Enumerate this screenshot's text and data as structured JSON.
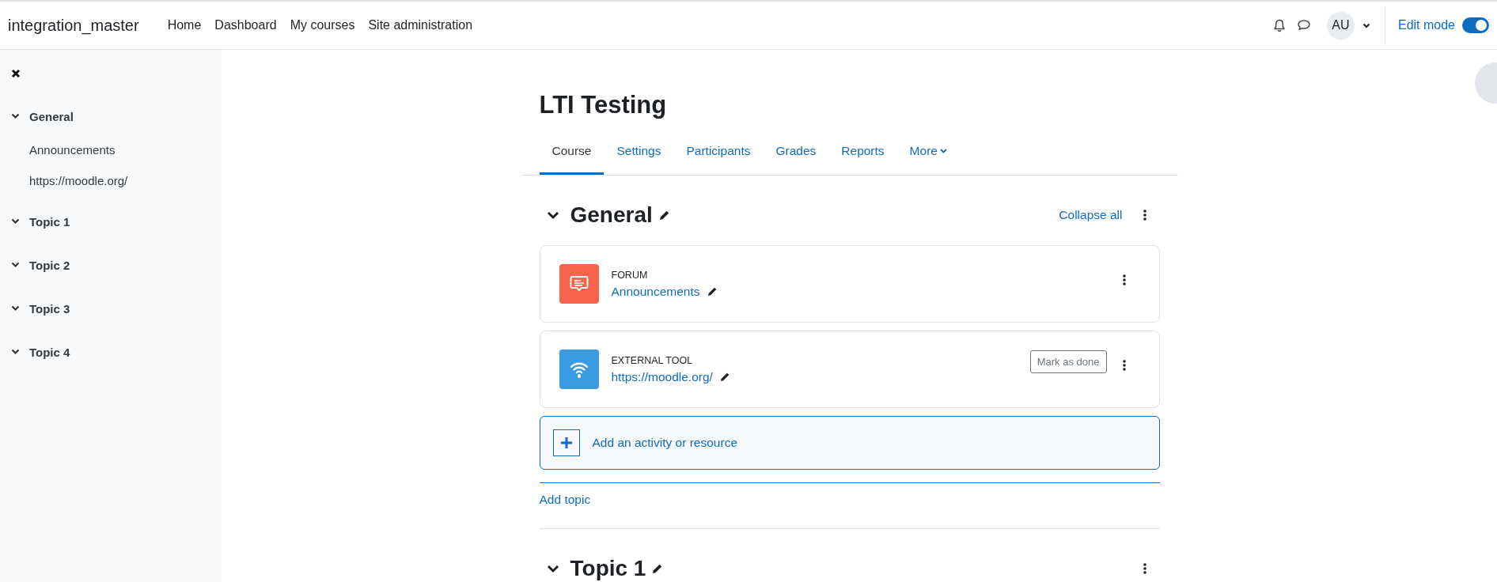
{
  "navbar": {
    "site_name": "integration_master",
    "links": [
      "Home",
      "Dashboard",
      "My courses",
      "Site administration"
    ],
    "avatar": "AU",
    "edit_mode": {
      "label": "Edit mode",
      "on": true
    }
  },
  "sidebar": {
    "sections": [
      {
        "title": "General",
        "expanded": true,
        "children": [
          {
            "label": "Announcements"
          },
          {
            "label": "https://moodle.org/"
          }
        ]
      },
      {
        "title": "Topic 1",
        "expanded": true
      },
      {
        "title": "Topic 2",
        "expanded": true
      },
      {
        "title": "Topic 3",
        "expanded": true
      },
      {
        "title": "Topic 4",
        "expanded": true
      }
    ]
  },
  "course": {
    "title": "LTI Testing",
    "tabs": [
      {
        "label": "Course",
        "selected": true,
        "has_menu": false
      },
      {
        "label": "Settings",
        "selected": false,
        "has_menu": false
      },
      {
        "label": "Participants",
        "selected": false,
        "has_menu": false
      },
      {
        "label": "Grades",
        "selected": false,
        "has_menu": false
      },
      {
        "label": "Reports",
        "selected": false,
        "has_menu": false
      },
      {
        "label": "More",
        "selected": false,
        "has_menu": true
      }
    ],
    "collapse_all": "Collapse all",
    "sections": [
      {
        "title": "General",
        "expanded": true,
        "activities": [
          {
            "kind": "forum",
            "type_label": "FORUM",
            "name": "Announcements",
            "color": "#f7634d"
          },
          {
            "kind": "lti",
            "type_label": "EXTERNAL TOOL",
            "name": "https://moodle.org/",
            "color": "#399be2",
            "completion_button": "Mark as done"
          }
        ],
        "add_activity": "Add an activity or resource"
      },
      {
        "title": "Topic 1",
        "expanded": true
      }
    ],
    "add_topic": "Add topic"
  }
}
